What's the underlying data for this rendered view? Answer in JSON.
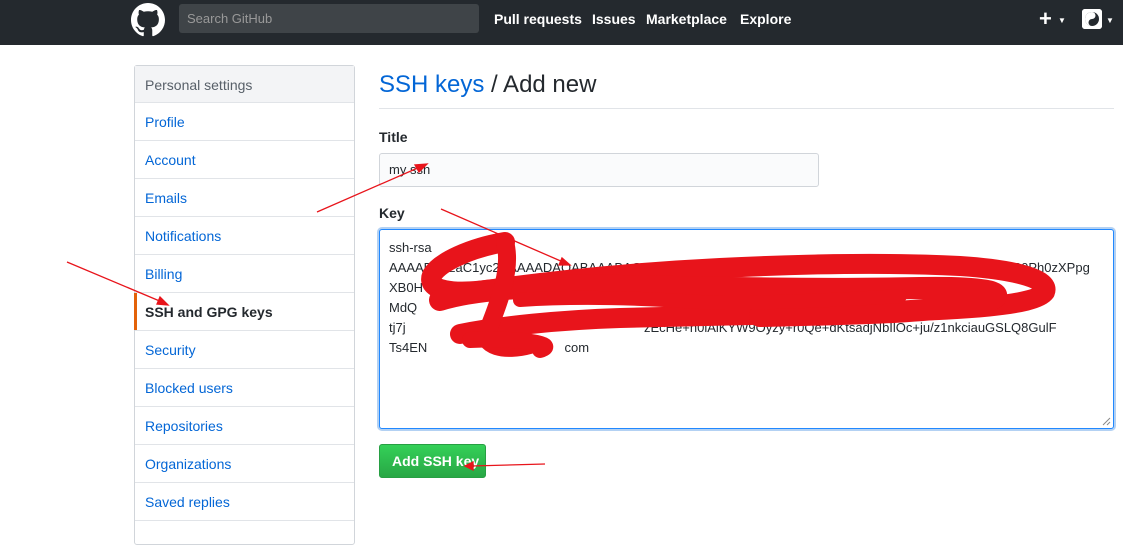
{
  "header": {
    "search_placeholder": "Search GitHub",
    "nav": [
      "Pull requests",
      "Issues",
      "Marketplace",
      "Explore"
    ],
    "plus_symbol": "+"
  },
  "sidebar": {
    "heading": "Personal settings",
    "items": [
      {
        "label": "Profile"
      },
      {
        "label": "Account"
      },
      {
        "label": "Emails"
      },
      {
        "label": "Notifications"
      },
      {
        "label": "Billing"
      },
      {
        "label": "SSH and GPG keys",
        "selected": true
      },
      {
        "label": "Security"
      },
      {
        "label": "Blocked users"
      },
      {
        "label": "Repositories"
      },
      {
        "label": "Organizations"
      },
      {
        "label": "Saved replies"
      }
    ]
  },
  "main": {
    "title_link": "SSH keys",
    "title_rest": " / Add new",
    "title_label": "Title",
    "title_value": "my ssh",
    "key_label": "Key",
    "key_lines": [
      "ssh-rsa",
      "AAAAB3NzaC1yc2EAAAADAQABAAABAQCxPEWYUG78BffRuDjUxluGAWMZfHUI5FVJne9s0NuHbWkxYtP0Ph0zXPpg",
      "XB0H",
      "MdQ                                                                                    Tmujj",
      "tj7j                                                                  zEcHe+h0iAiKYW9Oyzy+r0Qe+dKtsadjNbIlOc+ju/z1nkciauGSLQ8GulF",
      "Ts4EN                                      com"
    ],
    "add_button": "Add SSH key"
  },
  "colors": {
    "header_bg": "#24292e",
    "link": "#0366d6",
    "selected_accent": "#e36209",
    "button_green": "#28a745",
    "annotation_red": "#e8141b"
  }
}
